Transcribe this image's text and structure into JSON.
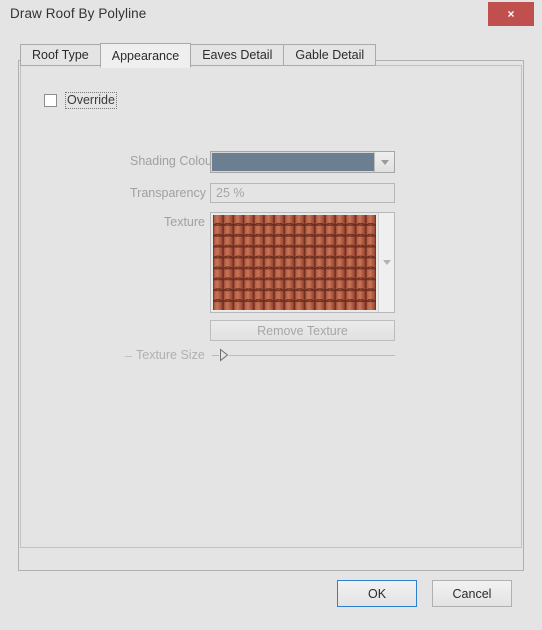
{
  "window": {
    "title": "Draw Roof By Polyline",
    "close_label": "×",
    "close_icon": "close-icon",
    "close_color": "#c0504d"
  },
  "tabs": [
    {
      "label": "Roof Type",
      "active": false
    },
    {
      "label": "Appearance",
      "active": true
    },
    {
      "label": "Eaves Detail",
      "active": false
    },
    {
      "label": "Gable Detail",
      "active": false
    }
  ],
  "appearance": {
    "override": {
      "label": "Override",
      "checked": false
    },
    "shading_colour": {
      "label": "Shading Colour",
      "value_color": "#6c7f90",
      "arrow_icon": "chevron-down-icon",
      "enabled": false
    },
    "transparency": {
      "label": "Transparency",
      "value": "25 %",
      "enabled": false
    },
    "texture": {
      "label": "Texture",
      "preview_name": "roof-tile-texture",
      "base_color": "#b0553d",
      "highlight_color": "#c2735c",
      "shadow_color": "#7d3524",
      "scroll_icon": "chevron-down-icon",
      "enabled": false
    },
    "remove_texture": {
      "label": "Remove Texture",
      "enabled": false
    },
    "texture_size": {
      "minus_label": "–",
      "label": "Texture Size",
      "value": 0,
      "min": 0,
      "max": 100,
      "enabled": false
    }
  },
  "footer": {
    "ok_label": "OK",
    "cancel_label": "Cancel",
    "ok_accent": "#2f7fd1"
  }
}
